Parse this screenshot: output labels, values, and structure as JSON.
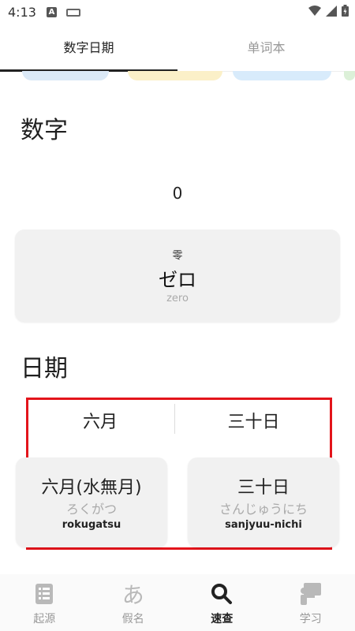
{
  "status_bar": {
    "time": "4:13",
    "a_icon_letter": "A"
  },
  "tabs": [
    {
      "label": "数字日期",
      "active": true
    },
    {
      "label": "单词本",
      "active": false
    }
  ],
  "numbers": {
    "section_title": "数字",
    "value": "0",
    "card": {
      "kanji": "零",
      "kana": "ゼロ",
      "romaji": "zero"
    }
  },
  "dates": {
    "section_title": "日期",
    "month_picker": "六月",
    "day_picker": "三十日",
    "month_card": {
      "main": "六月(水無月)",
      "kana": "ろくがつ",
      "romaji": "rokugatsu"
    },
    "day_card": {
      "main": "三十日",
      "kana": "さんじゅうにち",
      "romaji": "sanjyuu-nichi"
    }
  },
  "bottom_nav": [
    {
      "label": "起源",
      "icon": "list-icon",
      "active": false
    },
    {
      "label": "假名",
      "icon": "kana-a-icon",
      "glyph": "あ",
      "active": false
    },
    {
      "label": "速查",
      "icon": "search-icon",
      "active": true
    },
    {
      "label": "学习",
      "icon": "study-icon",
      "active": false
    }
  ],
  "colors": {
    "highlight": "#e3141b",
    "card_bg": "#f1f1f1"
  }
}
